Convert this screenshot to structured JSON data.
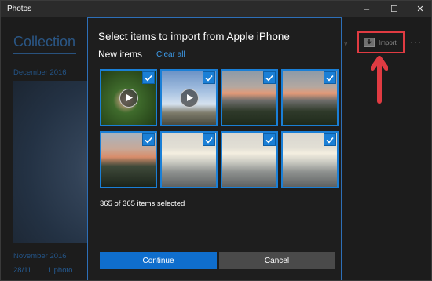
{
  "window": {
    "title": "Photos",
    "controls": {
      "minimize": "–",
      "maximize": "☐",
      "close": "✕"
    }
  },
  "background": {
    "collection_label": "Collection",
    "months": [
      "December 2016",
      "November 2016"
    ],
    "footer": {
      "date": "28/11",
      "count": "1 photo"
    },
    "toolbar": {
      "import_label": "Import",
      "more_label": "···",
      "chevron": "v"
    }
  },
  "dialog": {
    "title": "Select items to import from Apple iPhone",
    "section_title": "New items",
    "clear_all_label": "Clear all",
    "selection_status": "365 of 365 items selected",
    "continue_label": "Continue",
    "cancel_label": "Cancel",
    "thumbnails": [
      {
        "kind": "video",
        "scene": "hand-plants",
        "selected": true
      },
      {
        "kind": "video",
        "scene": "ladder-sky",
        "selected": true
      },
      {
        "kind": "photo",
        "scene": "sunset-trees",
        "selected": true
      },
      {
        "kind": "photo",
        "scene": "sunset-trees",
        "selected": true
      },
      {
        "kind": "photo",
        "scene": "sunset-trees-dark",
        "selected": true
      },
      {
        "kind": "photo",
        "scene": "sun-over-sea",
        "selected": true
      },
      {
        "kind": "photo",
        "scene": "sun-over-sea",
        "selected": true
      },
      {
        "kind": "photo",
        "scene": "sun-over-sea",
        "selected": true
      }
    ]
  },
  "colors": {
    "accent": "#1a7fd6",
    "highlight": "#e03b42"
  },
  "icons": {
    "import": "import-icon",
    "selected": "checkmark-icon",
    "play": "play-icon",
    "annotation": "red-arrow-icon"
  }
}
